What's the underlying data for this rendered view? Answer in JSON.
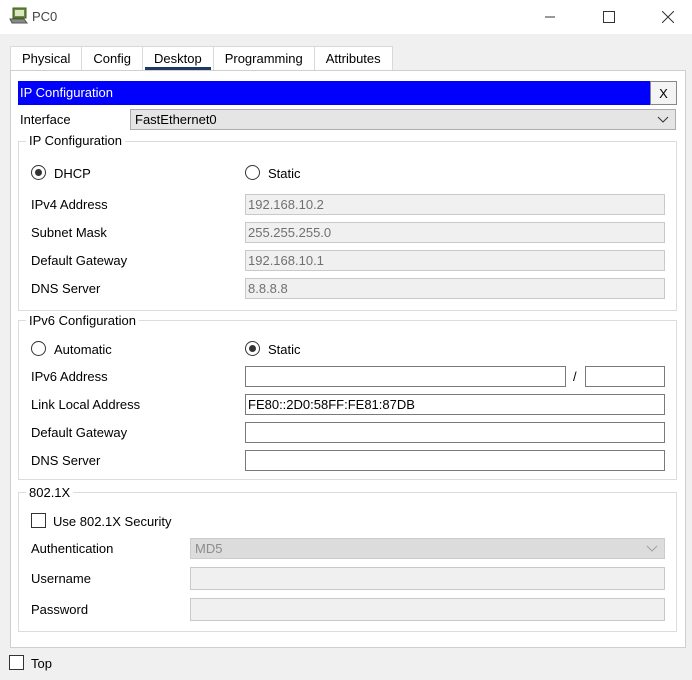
{
  "window": {
    "title": "PC0"
  },
  "icons": {
    "app": "pc-icon",
    "minimize": "minimize-icon",
    "maximize": "maximize-icon",
    "close": "close-icon",
    "dropdown": "chevron-down-icon"
  },
  "tabs": [
    {
      "label": "Physical",
      "active": false
    },
    {
      "label": "Config",
      "active": false
    },
    {
      "label": "Desktop",
      "active": true
    },
    {
      "label": "Programming",
      "active": false
    },
    {
      "label": "Attributes",
      "active": false
    }
  ],
  "ip_config": {
    "header": "IP Configuration",
    "close_label": "X",
    "interface_label": "Interface",
    "interface_value": "FastEthernet0",
    "ipv4": {
      "group_title": "IP Configuration",
      "dhcp_label": "DHCP",
      "static_label": "Static",
      "selected": "DHCP",
      "address_label": "IPv4 Address",
      "address_value": "192.168.10.2",
      "mask_label": "Subnet Mask",
      "mask_value": "255.255.255.0",
      "gateway_label": "Default Gateway",
      "gateway_value": "192.168.10.1",
      "dns_label": "DNS Server",
      "dns_value": "8.8.8.8"
    },
    "ipv6": {
      "group_title": "IPv6 Configuration",
      "automatic_label": "Automatic",
      "static_label": "Static",
      "selected": "Static",
      "address_label": "IPv6 Address",
      "address_value": "",
      "prefix_separator": "/",
      "prefix_value": "",
      "link_local_label": "Link Local Address",
      "link_local_value": "FE80::2D0:58FF:FE81:87DB",
      "gateway_label": "Default Gateway",
      "gateway_value": "",
      "dns_label": "DNS Server",
      "dns_value": ""
    },
    "dot1x": {
      "group_title": "802.1X",
      "use_security_label": "Use 802.1X Security",
      "use_security_checked": false,
      "auth_label": "Authentication",
      "auth_value": "MD5",
      "username_label": "Username",
      "username_value": "",
      "password_label": "Password",
      "password_value": ""
    }
  },
  "footer": {
    "top_label": "Top",
    "top_checked": false
  }
}
